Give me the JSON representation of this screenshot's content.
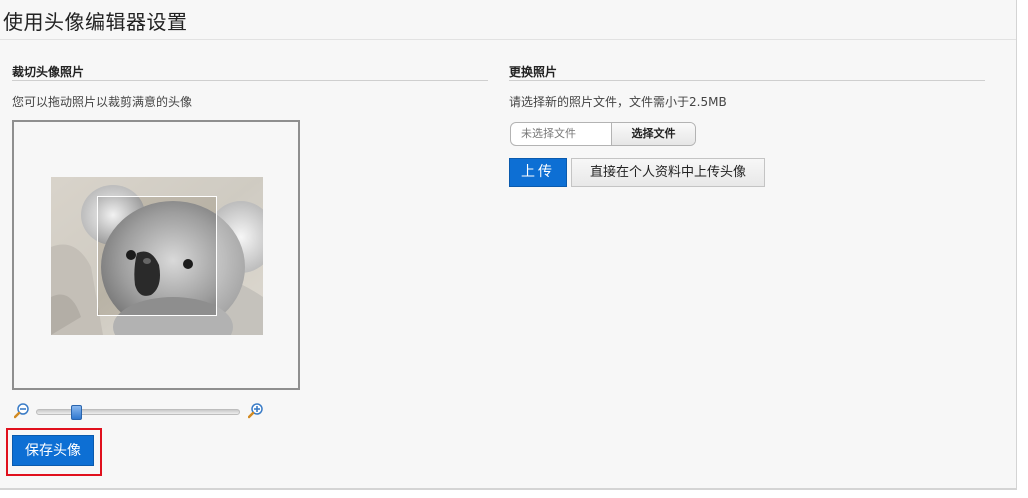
{
  "page": {
    "title": "使用头像编辑器设置"
  },
  "crop_section": {
    "title": "裁切头像照片",
    "hint": "您可以拖动照片以裁剪满意的头像",
    "zoom_level": 0.18,
    "save_label": "保存头像"
  },
  "replace_section": {
    "title": "更换照片",
    "hint": "请选择新的照片文件，文件需小于2.5MB",
    "file_status": "未选择文件",
    "choose_label": "选择文件",
    "upload_label": "上传",
    "profile_upload_label": "直接在个人资料中上传头像"
  },
  "colors": {
    "primary": "#0d6fd4",
    "highlight": "#e0101d"
  },
  "icons": {
    "zoom_out": "zoom-out-icon",
    "zoom_in": "zoom-in-icon"
  }
}
